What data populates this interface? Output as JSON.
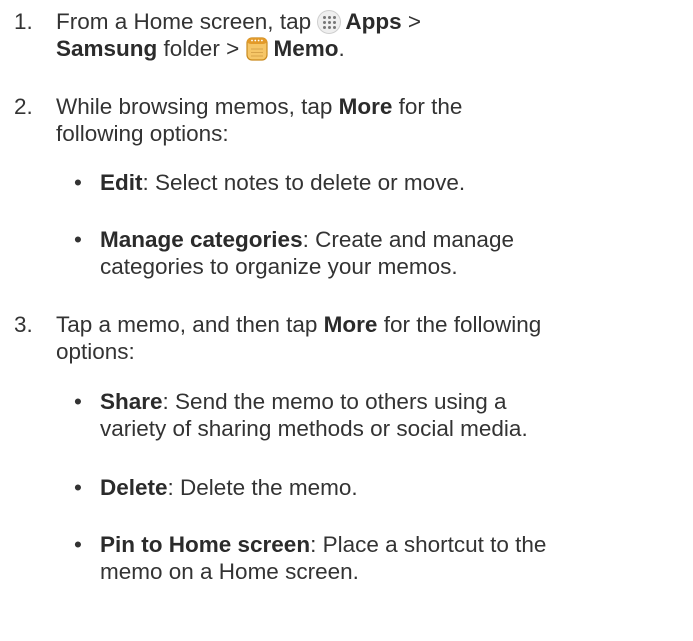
{
  "steps": [
    {
      "number": "1.",
      "lines": [
        {
          "pre": "From a Home screen, tap ",
          "icon": "apps-icon",
          "bold": "Apps",
          "post": " >"
        },
        {
          "bold": "Samsung",
          "mid": " folder > ",
          "icon": "memo-icon",
          "bold2": "Memo",
          "post": "."
        }
      ]
    },
    {
      "number": "2.",
      "lines": [
        {
          "pre": "While browsing memos, tap ",
          "bold": "More",
          "post": " for the"
        },
        {
          "text": "following options:"
        }
      ],
      "bullets": [
        {
          "bold": "Edit",
          "lines": [
            ": Select notes to delete or move."
          ]
        },
        {
          "bold": "Manage categories",
          "lines": [
            ": Create and manage",
            "categories to organize your memos."
          ]
        }
      ]
    },
    {
      "number": "3.",
      "lines": [
        {
          "pre": "Tap a memo, and then tap ",
          "bold": "More",
          "post": " for the following"
        },
        {
          "text": "options:"
        }
      ],
      "bullets": [
        {
          "bold": "Share",
          "lines": [
            ": Send the memo to others using a",
            "variety of sharing methods or social media."
          ]
        },
        {
          "bold": "Delete",
          "lines": [
            ": Delete the memo."
          ]
        },
        {
          "bold": "Pin to Home screen",
          "lines": [
            ": Place a shortcut to the",
            "memo on a Home screen."
          ]
        }
      ]
    }
  ],
  "bullet_char": "•",
  "colors": {
    "text": "#333333",
    "memo_icon_fill": "#f6c667",
    "memo_icon_stroke": "#c98a1e"
  }
}
